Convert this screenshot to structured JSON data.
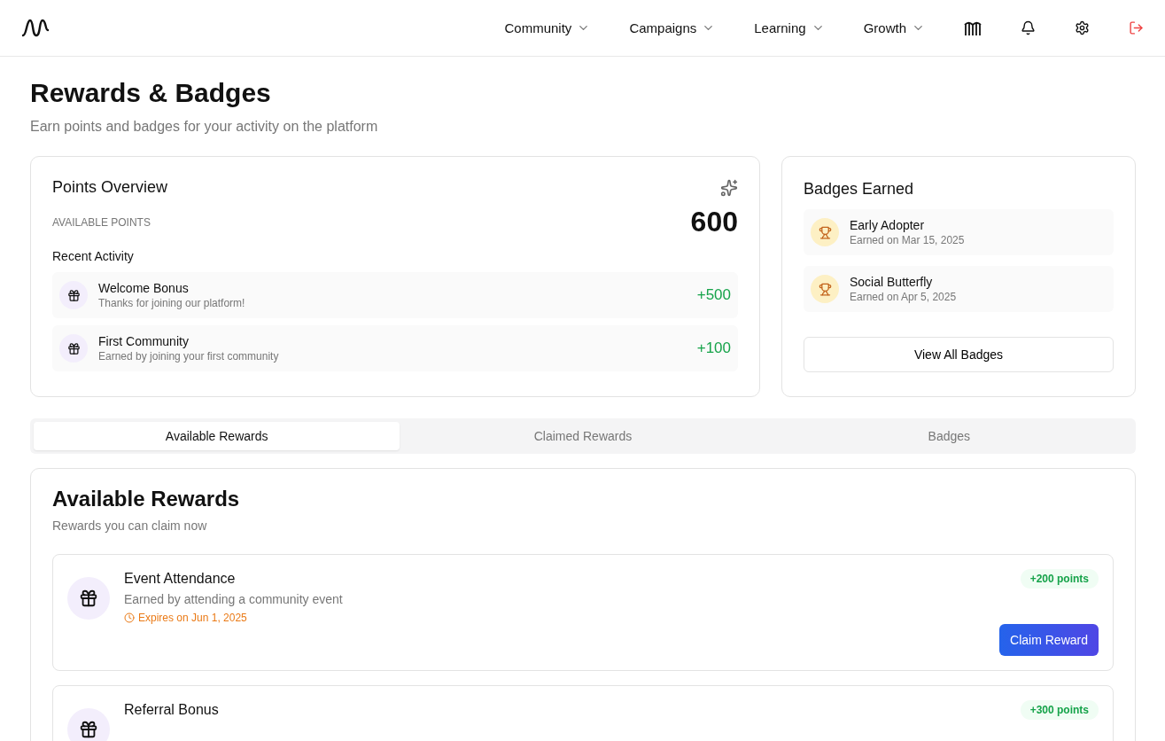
{
  "nav": {
    "items": [
      {
        "label": "Community"
      },
      {
        "label": "Campaigns"
      },
      {
        "label": "Learning"
      },
      {
        "label": "Growth"
      }
    ]
  },
  "page": {
    "title": "Rewards & Badges",
    "subtitle": "Earn points and badges for your activity on the platform"
  },
  "points_overview": {
    "title": "Points Overview",
    "available_label": "AVAILABLE POINTS",
    "available_value": "600",
    "recent_title": "Recent Activity",
    "activity": [
      {
        "title": "Welcome Bonus",
        "description": "Thanks for joining our platform!",
        "points": "+500"
      },
      {
        "title": "First Community",
        "description": "Earned by joining your first community",
        "points": "+100"
      }
    ]
  },
  "badges_earned": {
    "title": "Badges Earned",
    "badges": [
      {
        "name": "Early Adopter",
        "date": "Earned on Mar 15, 2025"
      },
      {
        "name": "Social Butterfly",
        "date": "Earned on Apr 5, 2025"
      }
    ],
    "button": "View All Badges"
  },
  "tabs": [
    {
      "label": "Available Rewards",
      "selected": true
    },
    {
      "label": "Claimed Rewards",
      "selected": false
    },
    {
      "label": "Badges",
      "selected": false
    }
  ],
  "rewards": {
    "title": "Available Rewards",
    "subtitle": "Rewards you can claim now",
    "items": [
      {
        "title": "Event Attendance",
        "description": "Earned by attending a community event",
        "expires": "Expires on Jun 1, 2025",
        "points": "+200 points",
        "button": "Claim Reward"
      },
      {
        "title": "Referral Bonus",
        "points": "+300 points"
      }
    ]
  }
}
